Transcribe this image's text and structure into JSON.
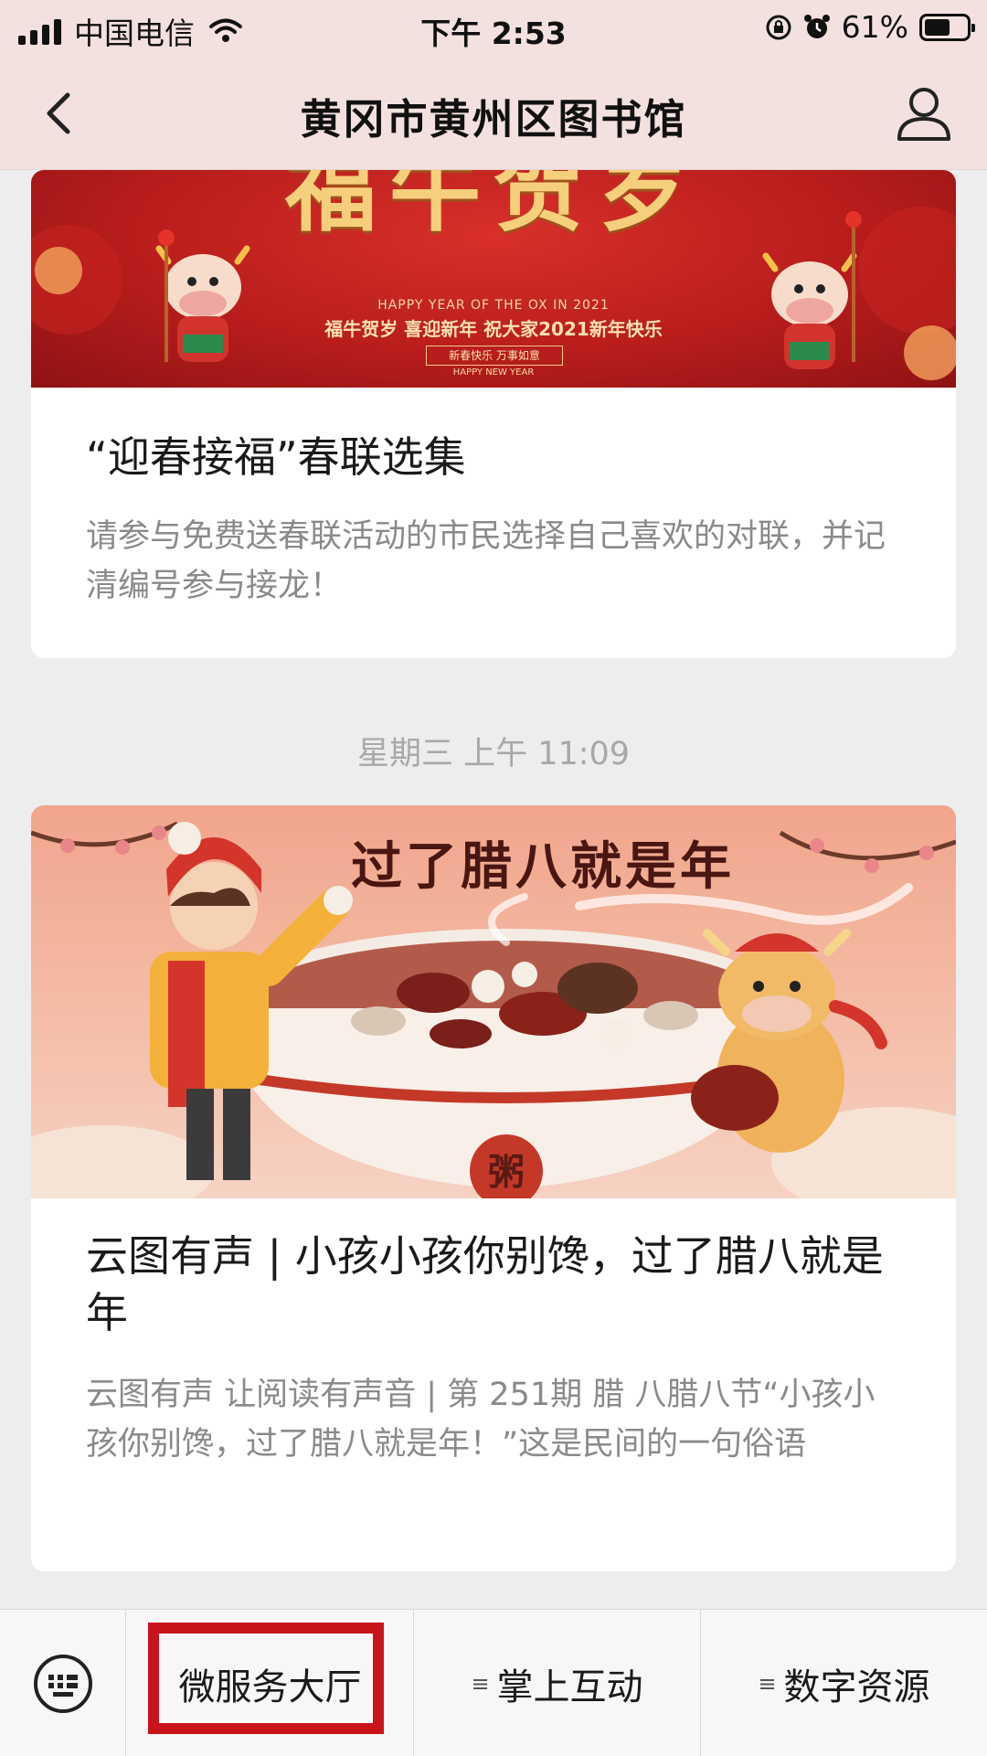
{
  "status_bar": {
    "carrier": "中国电信",
    "time": "下午 2:53",
    "battery_text": "61%",
    "battery_level": 0.61,
    "icons": [
      "signal-icon",
      "wifi-icon",
      "rotation-lock-icon",
      "alarm-icon",
      "battery-icon"
    ]
  },
  "nav": {
    "title": "黄冈市黄州区图书馆",
    "back_icon": "chevron-left-icon",
    "profile_icon": "person-icon"
  },
  "articles": [
    {
      "banner": {
        "headline": "福牛贺岁",
        "line1": "HAPPY YEAR OF THE OX IN 2021",
        "line2": "福牛贺岁 喜迎新年 祝大家2021新年快乐",
        "line3": "新春快乐 万事如意",
        "line4": "HAPPY NEW YEAR"
      },
      "title": "“迎春接福”春联选集",
      "description": "请参与免费送春联活动的市民选择自己喜欢的对联，并记清编号参与接龙！"
    },
    {
      "banner": {
        "headline": "过了腊八就是年",
        "bowl_label": "粥"
      },
      "title": "云图有声 | 小孩小孩你别馋，过了腊八就是年",
      "description": "云图有声  让阅读有声音 | 第 251期 腊 八腊八节“小孩小孩你别馋，过了腊八就是年！”这是民间的一句俗语"
    }
  ],
  "timestamp": "星期三 上午 11:09",
  "bottom_menu": {
    "keyboard_icon": "keyboard-icon",
    "items": [
      {
        "label": "微服务大厅"
      },
      {
        "label": "掌上互动",
        "icon": "menu-lines-icon"
      },
      {
        "label": "数字资源",
        "icon": "menu-lines-icon"
      }
    ],
    "highlight_color": "#c9141c"
  },
  "colors": {
    "nav_background": "#f3e1df",
    "page_background": "#ededed",
    "card_background": "#ffffff",
    "description_text": "#8a8a8a"
  }
}
